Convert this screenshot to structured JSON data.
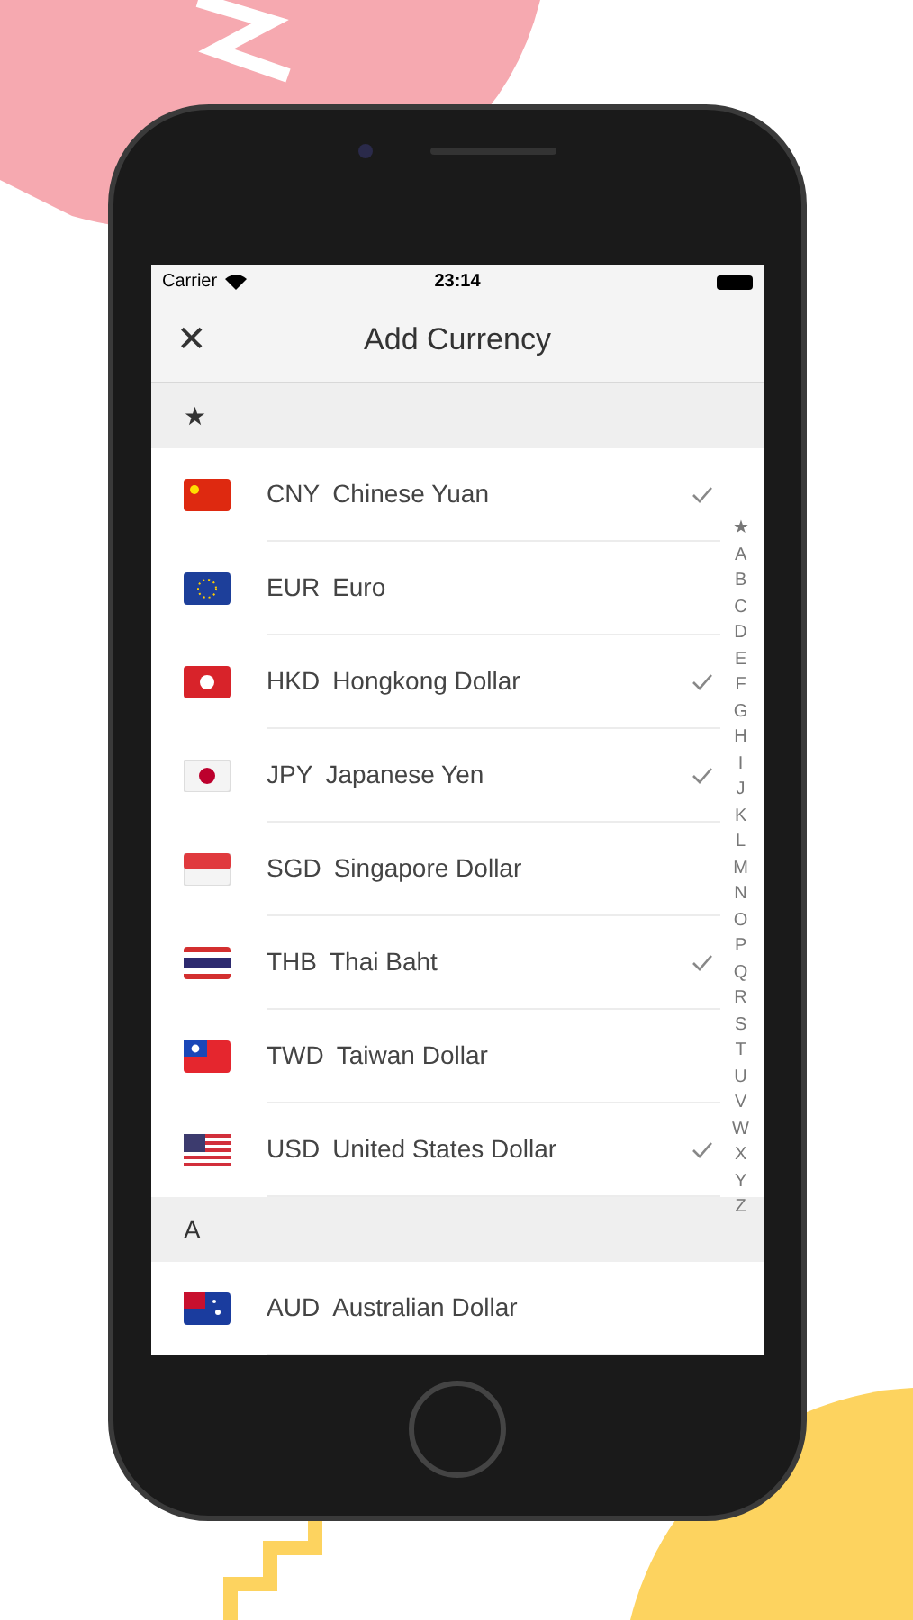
{
  "status_bar": {
    "carrier": "Carrier",
    "time": "23:14"
  },
  "nav": {
    "close": "✕",
    "title": "Add Currency"
  },
  "sections": [
    {
      "header": "★",
      "items": [
        {
          "code": "CNY",
          "name": "Chinese Yuan",
          "checked": true
        },
        {
          "code": "EUR",
          "name": "Euro",
          "checked": false
        },
        {
          "code": "HKD",
          "name": "Hongkong Dollar",
          "checked": true
        },
        {
          "code": "JPY",
          "name": "Japanese Yen",
          "checked": true
        },
        {
          "code": "SGD",
          "name": "Singapore Dollar",
          "checked": false
        },
        {
          "code": "THB",
          "name": "Thai Baht",
          "checked": true
        },
        {
          "code": "TWD",
          "name": "Taiwan Dollar",
          "checked": false
        },
        {
          "code": "USD",
          "name": "United States Dollar",
          "checked": true
        }
      ]
    },
    {
      "header": "A",
      "items": [
        {
          "code": "AUD",
          "name": "Australian Dollar",
          "checked": false
        }
      ]
    }
  ],
  "index": [
    "★",
    "A",
    "B",
    "C",
    "D",
    "E",
    "F",
    "G",
    "H",
    "I",
    "J",
    "K",
    "L",
    "M",
    "N",
    "O",
    "P",
    "Q",
    "R",
    "S",
    "T",
    "U",
    "V",
    "W",
    "X",
    "Y",
    "Z"
  ]
}
